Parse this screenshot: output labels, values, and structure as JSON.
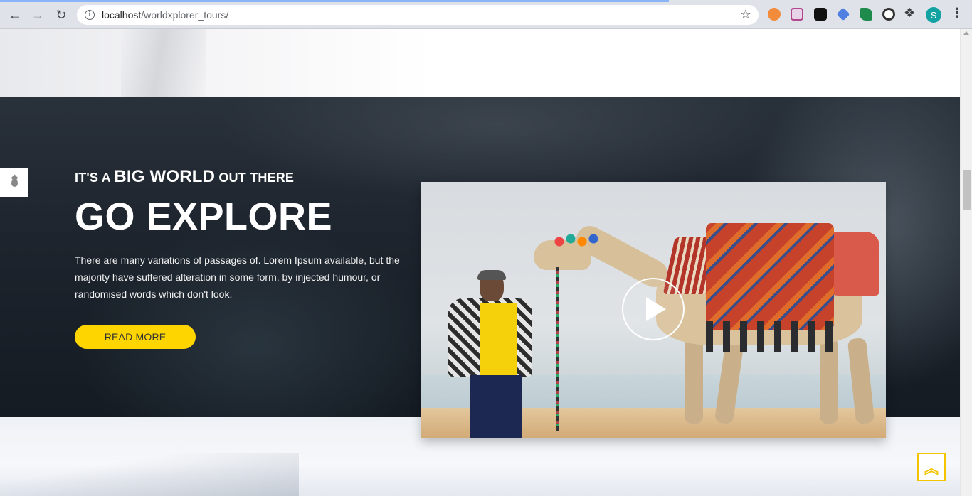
{
  "browser": {
    "url_host": "localhost",
    "url_path": "/worldxplorer_tours/",
    "avatar_letter": "S",
    "icons": {
      "back": "arrow-back-icon",
      "forward": "arrow-forward-icon",
      "reload": "reload-icon",
      "info": "site-info-icon",
      "bookmark": "star-icon",
      "extensions": "puzzle-icon",
      "menu": "more-vert-icon"
    }
  },
  "hero": {
    "kicker_pre": "IT'S A ",
    "kicker_big": "BIG WORLD",
    "kicker_post": " OUT THERE",
    "headline": "GO EXPLORE",
    "description": "There are many variations of passages of. Lorem Ipsum available, but the majority have suffered alteration in some form, by injected humour, or randomised words which don't look.",
    "button_label": "READ MORE"
  },
  "video": {
    "play_icon": "play-icon"
  },
  "side_tab": {
    "icon": "drop-icon"
  },
  "back_to_top": {
    "icon": "double-chevron-up-icon",
    "glyph": "︽"
  },
  "colors": {
    "accent_yellow": "#ffd500",
    "hero_dark": "#1d242d"
  }
}
